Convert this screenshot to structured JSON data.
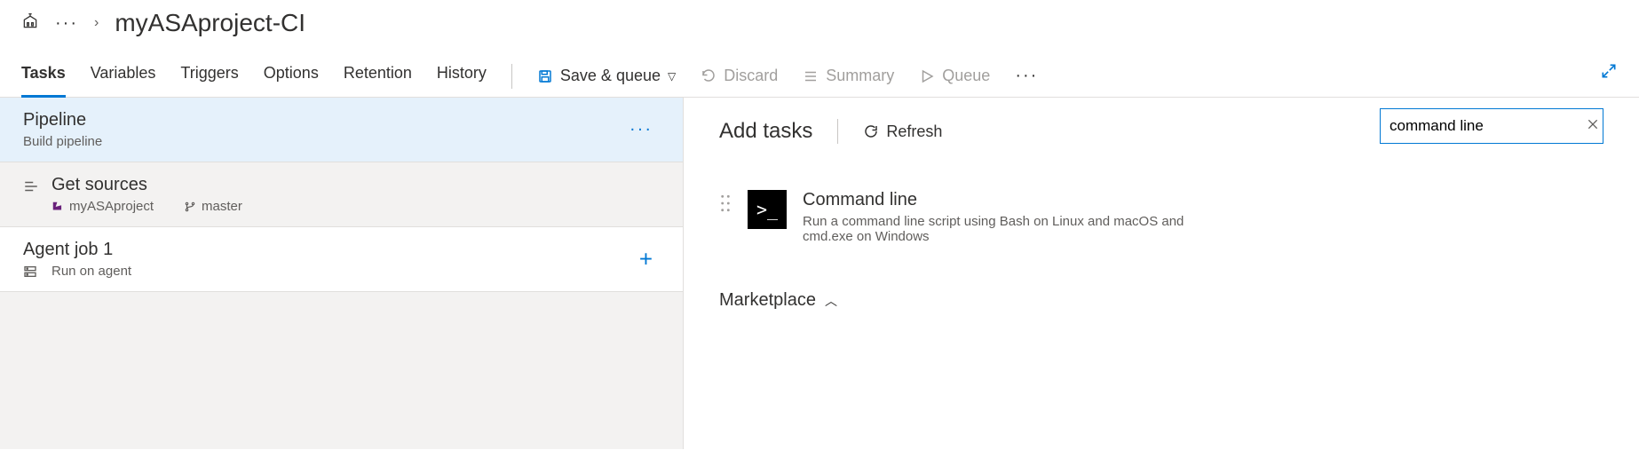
{
  "breadcrumb": {
    "ellipsis": "···",
    "chevron": "›",
    "title": "myASAproject-CI"
  },
  "tabs": [
    "Tasks",
    "Variables",
    "Triggers",
    "Options",
    "Retention",
    "History"
  ],
  "active_tab": 0,
  "toolbar": {
    "save_queue": "Save & queue",
    "discard": "Discard",
    "summary": "Summary",
    "queue": "Queue",
    "more": "···"
  },
  "left": {
    "pipeline": {
      "title": "Pipeline",
      "subtitle": "Build pipeline",
      "more": "···"
    },
    "sources": {
      "title": "Get sources",
      "repo": "myASAproject",
      "branch": "master"
    },
    "agent": {
      "title": "Agent job 1",
      "subtitle": "Run on agent",
      "add": "+"
    }
  },
  "right": {
    "heading": "Add tasks",
    "refresh": "Refresh",
    "search_value": "command line",
    "task": {
      "name": "Command line",
      "desc": "Run a command line script using Bash on Linux and macOS and cmd.exe on Windows",
      "icon_text": ">_"
    },
    "marketplace": "Marketplace"
  }
}
